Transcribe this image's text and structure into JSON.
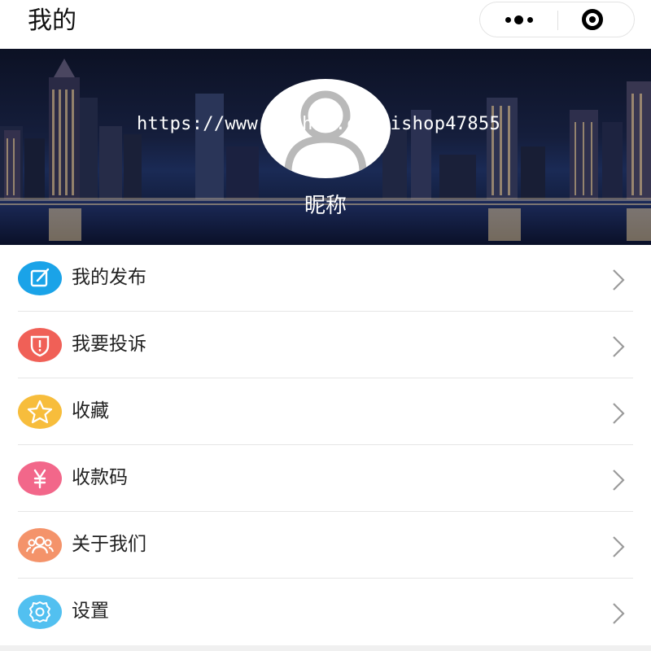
{
  "header": {
    "title": "我的",
    "more_icon": "more-dots-icon",
    "close_icon": "target-close-icon"
  },
  "profile": {
    "nickname": "昵称",
    "watermark": "https://www.huzhan.com/ishop47855",
    "avatar_icon": "user-avatar-icon"
  },
  "menu": {
    "items": [
      {
        "label": "我的发布",
        "icon": "edit-icon",
        "color": "#1aa3e8"
      },
      {
        "label": "我要投诉",
        "icon": "shield-alert-icon",
        "color": "#f06057"
      },
      {
        "label": "收藏",
        "icon": "star-icon",
        "color": "#f7bd3c"
      },
      {
        "label": "收款码",
        "icon": "yen-icon",
        "color": "#f2678a"
      },
      {
        "label": "关于我们",
        "icon": "group-icon",
        "color": "#f4936a"
      },
      {
        "label": "设置",
        "icon": "gear-icon",
        "color": "#52c0f0"
      }
    ]
  }
}
